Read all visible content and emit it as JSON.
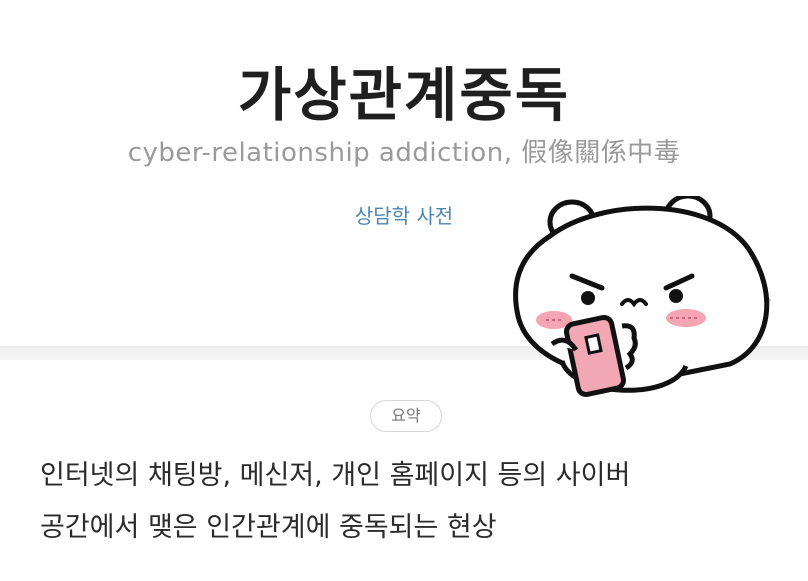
{
  "entry": {
    "title": "가상관계중독",
    "subtitle": "cyber-relationship addiction, 假像關係中毒",
    "source": "상담학 사전"
  },
  "summary": {
    "badge": "요약",
    "text_line1": "인터넷의 채팅방, 메신저, 개인 홈페이지 등의 사이버",
    "text_line2": "공간에서 맺은 인간관계에 중독되는 현상"
  },
  "sticker": {
    "icon": "bear-with-phone-sticker-icon"
  },
  "colors": {
    "source_link": "#4a86b4",
    "subtitle": "#9a9a9a",
    "phone": "#f2a7b4",
    "blush": "#f4a4b3"
  }
}
